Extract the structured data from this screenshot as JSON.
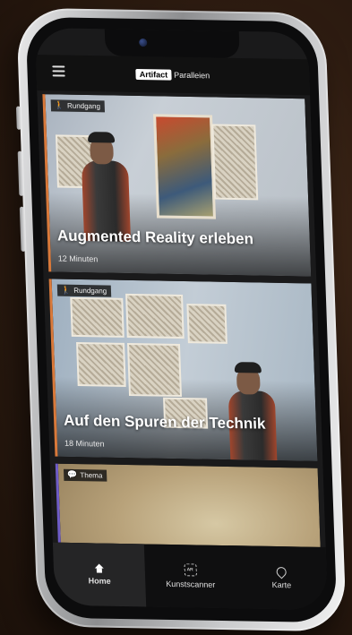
{
  "header": {
    "brand_logo": "Artifact",
    "brand_suffix": "Paralleien"
  },
  "cards": [
    {
      "tag_icon": "walking-person-icon",
      "tag": "Rundgang",
      "title": "Augmented Reality erleben",
      "meta": "12 Minuten",
      "accent": "#d9793a"
    },
    {
      "tag_icon": "walking-person-icon",
      "tag": "Rundgang",
      "title": "Auf den Spuren der Technik",
      "meta": "18 Minuten",
      "accent": "#d9793a"
    },
    {
      "tag_icon": "speech-bubble-icon",
      "tag": "Thema",
      "title": "",
      "meta": "",
      "accent": "#6e5cc7"
    }
  ],
  "tabs": [
    {
      "label": "Home",
      "icon": "home-icon",
      "active": true
    },
    {
      "label": "Kunstscanner",
      "icon": "ar-scan-icon",
      "active": false
    },
    {
      "label": "Karte",
      "icon": "map-pin-icon",
      "active": false
    }
  ],
  "colors": {
    "background": "#2e1c11",
    "rundgang_accent": "#d9793a",
    "thema_accent": "#6e5cc7",
    "screen": "#1a1a1b"
  }
}
